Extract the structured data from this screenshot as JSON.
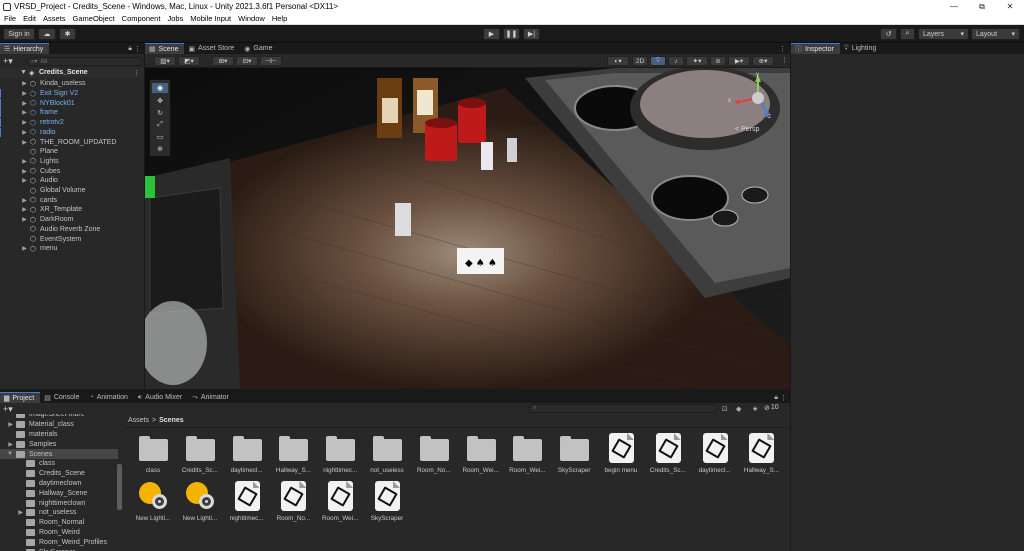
{
  "window": {
    "title": "VRSD_Project - Credits_Scene - Windows, Mac, Linux - Unity 2021.3.6f1 Personal <DX11>",
    "buttons": [
      "—",
      "⧉",
      "✕"
    ]
  },
  "menubar": [
    "File",
    "Edit",
    "Assets",
    "GameObject",
    "Component",
    "Jobs",
    "Mobile Input",
    "Window",
    "Help"
  ],
  "toolbar": {
    "sign_in": "Sign in",
    "layers": "Layers",
    "layout": "Layout"
  },
  "hierarchy": {
    "tab": "Hierarchy",
    "search_placeholder": "All",
    "scene": "Credits_Scene",
    "items": [
      {
        "label": "Kinda_useless",
        "prefab": false,
        "expand": true
      },
      {
        "label": "Exit Sign V2",
        "prefab": true,
        "expand": true
      },
      {
        "label": "NYBlock01",
        "prefab": true,
        "expand": true
      },
      {
        "label": "frame",
        "prefab": true,
        "expand": true
      },
      {
        "label": "retrotv2",
        "prefab": true,
        "expand": true
      },
      {
        "label": "radio",
        "prefab": true,
        "expand": true
      },
      {
        "label": "THE_ROOM_UPDATED",
        "prefab": false,
        "expand": true
      },
      {
        "label": "Plane",
        "prefab": false,
        "expand": false
      },
      {
        "label": "Lights",
        "prefab": false,
        "expand": true
      },
      {
        "label": "Cubes",
        "prefab": false,
        "expand": true
      },
      {
        "label": "Audio",
        "prefab": false,
        "expand": true
      },
      {
        "label": "Global Volume",
        "prefab": false,
        "expand": false
      },
      {
        "label": "cards",
        "prefab": false,
        "expand": true
      },
      {
        "label": "XR_Template",
        "prefab": false,
        "expand": true
      },
      {
        "label": "DarkRoom",
        "prefab": false,
        "expand": true
      },
      {
        "label": "Audio Reverb Zone",
        "prefab": false,
        "expand": false
      },
      {
        "label": "EventSystem",
        "prefab": false,
        "expand": false
      },
      {
        "label": "menu",
        "prefab": false,
        "expand": true
      }
    ]
  },
  "center_tabs": [
    "Scene",
    "Asset Store",
    "Game"
  ],
  "scene": {
    "mode_2d": "2D",
    "persp": "Persp",
    "gizmo_y": "y",
    "gizmo_x": "x",
    "gizmo_z": "z"
  },
  "right_tabs": [
    "Inspector",
    "Lighting"
  ],
  "bottom_tabs": [
    "Project",
    "Console",
    "Animation",
    "Audio Mixer",
    "Animator"
  ],
  "project": {
    "breadcrumb_root": "Assets",
    "breadcrumb_sep": ">",
    "breadcrumb_current": "Scenes",
    "hidden_count": "10",
    "tree": [
      {
        "label": "ImageSheet Inbre",
        "indent": 1,
        "arrow": "",
        "selected": false
      },
      {
        "label": "Material_class",
        "indent": 1,
        "arrow": "▶",
        "selected": false
      },
      {
        "label": "materials",
        "indent": 1,
        "arrow": "",
        "selected": false
      },
      {
        "label": "Samples",
        "indent": 1,
        "arrow": "▶",
        "selected": false
      },
      {
        "label": "Scenes",
        "indent": 1,
        "arrow": "▼",
        "selected": true
      },
      {
        "label": "class",
        "indent": 2,
        "arrow": "",
        "selected": false
      },
      {
        "label": "Credits_Scene",
        "indent": 2,
        "arrow": "",
        "selected": false
      },
      {
        "label": "daytimeclown",
        "indent": 2,
        "arrow": "",
        "selected": false
      },
      {
        "label": "Hallway_Scene",
        "indent": 2,
        "arrow": "",
        "selected": false
      },
      {
        "label": "nighttimeclown",
        "indent": 2,
        "arrow": "",
        "selected": false
      },
      {
        "label": "not_useless",
        "indent": 2,
        "arrow": "▶",
        "selected": false
      },
      {
        "label": "Room_Normal",
        "indent": 2,
        "arrow": "",
        "selected": false
      },
      {
        "label": "Room_Weird",
        "indent": 2,
        "arrow": "",
        "selected": false
      },
      {
        "label": "Room_Weird_Profiles",
        "indent": 2,
        "arrow": "",
        "selected": false
      },
      {
        "label": "SkyScraper",
        "indent": 2,
        "arrow": "",
        "selected": false
      }
    ],
    "assets_row1": [
      {
        "label": "class",
        "kind": "folder"
      },
      {
        "label": "Credits_Sc...",
        "kind": "folder"
      },
      {
        "label": "daytimecl...",
        "kind": "folder"
      },
      {
        "label": "Hallway_S...",
        "kind": "folder"
      },
      {
        "label": "nighttimec...",
        "kind": "folder"
      },
      {
        "label": "not_useless",
        "kind": "folder"
      },
      {
        "label": "Room_No...",
        "kind": "folder"
      },
      {
        "label": "Room_Wei...",
        "kind": "folder"
      },
      {
        "label": "Room_Wei...",
        "kind": "folder"
      },
      {
        "label": "SkyScraper",
        "kind": "folder"
      },
      {
        "label": "begin menu",
        "kind": "scene"
      },
      {
        "label": "Credits_Sc...",
        "kind": "scene"
      },
      {
        "label": "daytimecl...",
        "kind": "scene"
      },
      {
        "label": "Hallway_S...",
        "kind": "scene"
      }
    ],
    "assets_row2": [
      {
        "label": "New Lighti...",
        "kind": "lighting"
      },
      {
        "label": "New Lighti...",
        "kind": "lighting"
      },
      {
        "label": "nighttimec...",
        "kind": "scene"
      },
      {
        "label": "Room_No...",
        "kind": "scene"
      },
      {
        "label": "Room_Wei...",
        "kind": "scene"
      },
      {
        "label": "SkyScraper",
        "kind": "scene"
      }
    ]
  },
  "colors": {
    "accent": "#3a7ce0",
    "prefab_blue": "#7cb2f5",
    "jar_red": "#c0191a"
  }
}
